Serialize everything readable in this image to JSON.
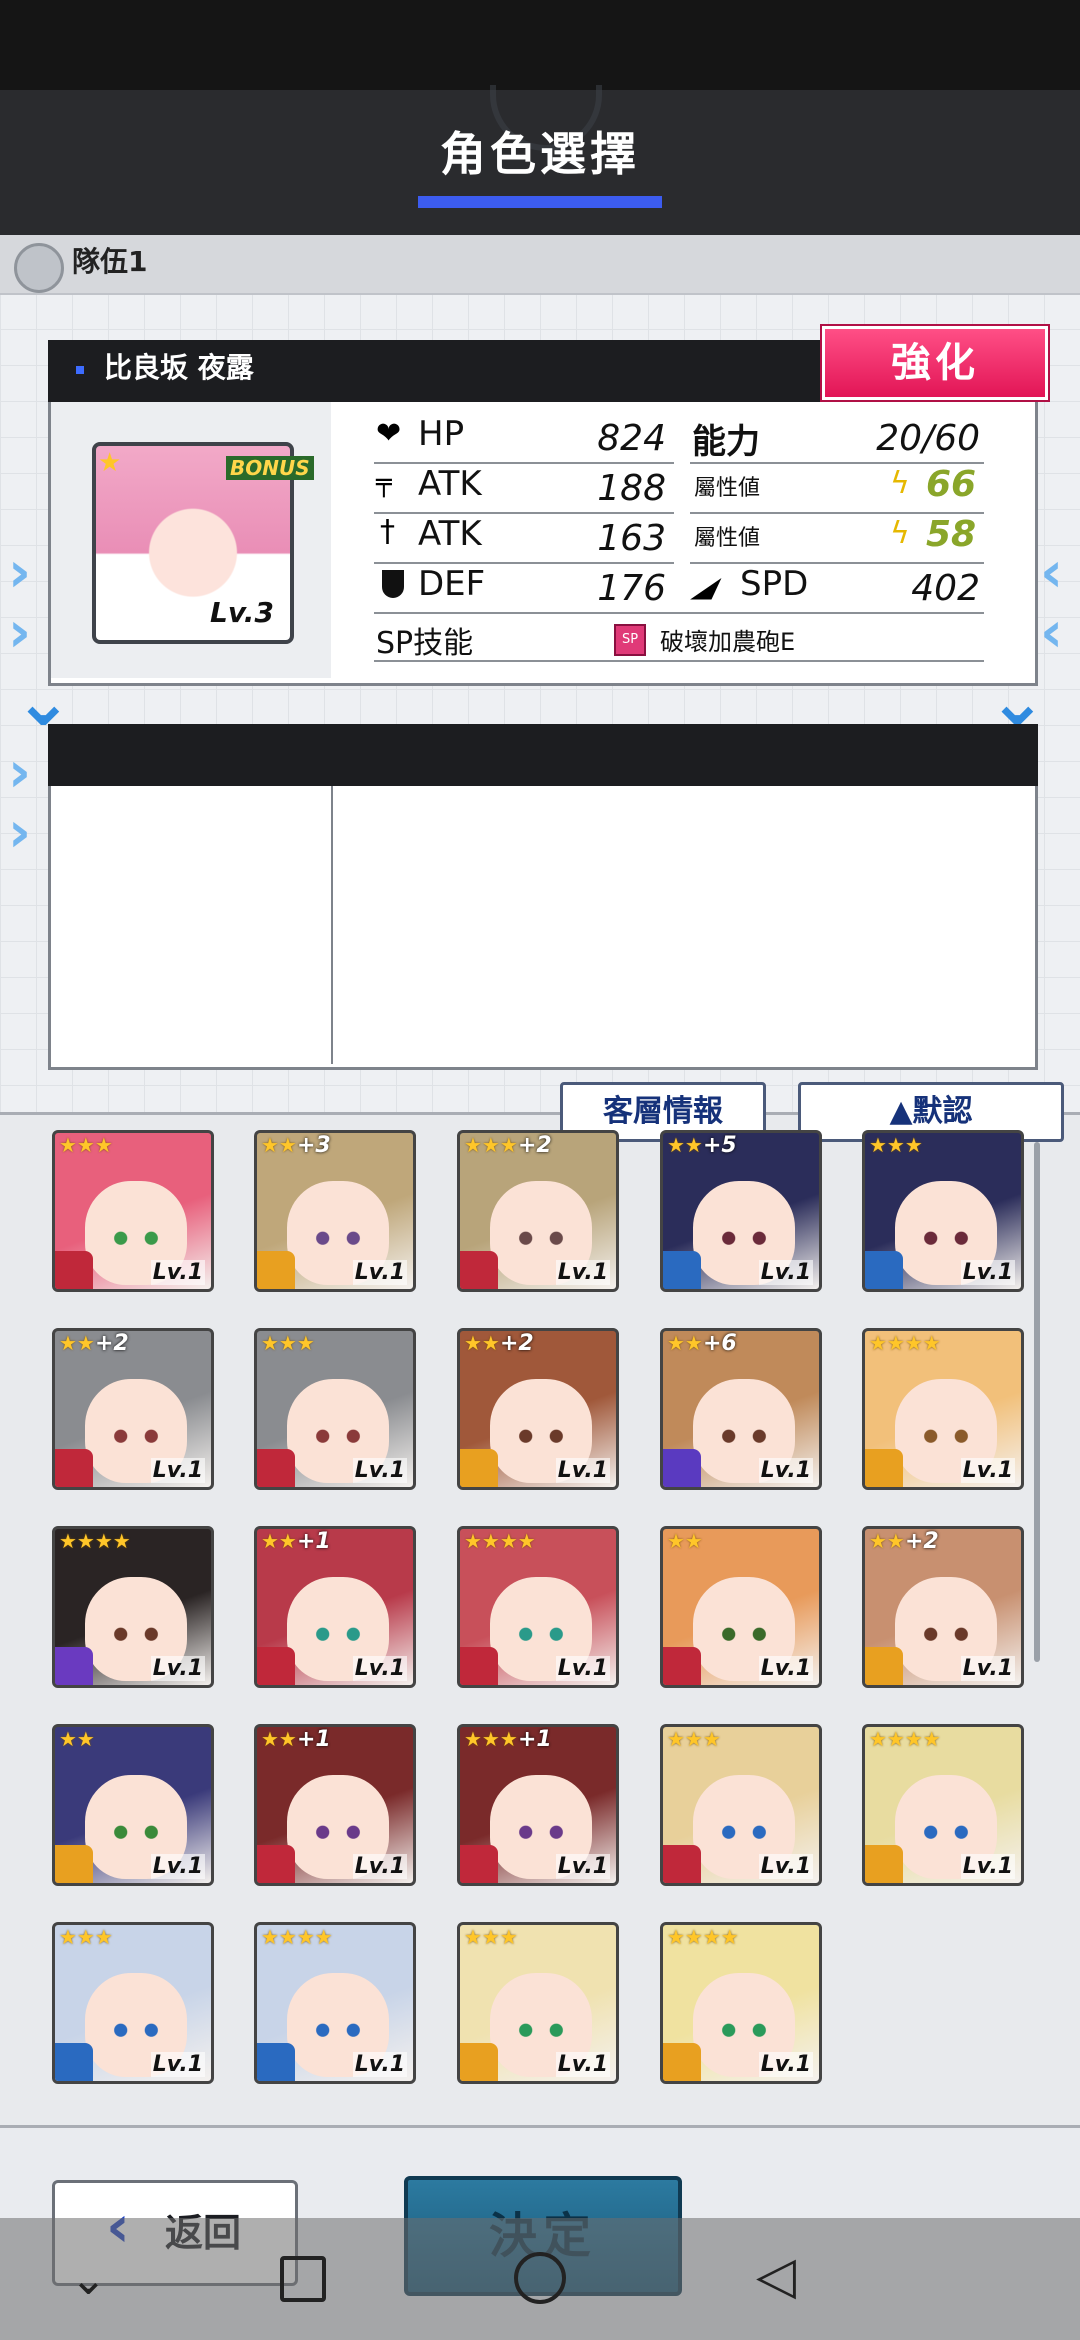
{
  "header": {
    "title": "角色選擇"
  },
  "team": {
    "label": "隊伍1"
  },
  "enhance_button": "強化",
  "selected": {
    "name": "比良坂 夜露",
    "bonus": "BONUS",
    "level": "Lv.3",
    "stars": "★",
    "stats": {
      "hp_label": "HP",
      "hp": "824",
      "atk1_label": "ATK",
      "atk1": "188",
      "atk2_label": "ATK",
      "atk2": "163",
      "def_label": "DEF",
      "def": "176",
      "ability_label": "能力",
      "ability": "20/60",
      "attr_label": "屬性値",
      "attr1": "66",
      "attr2": "58",
      "spd_label": "SPD",
      "spd": "402",
      "sp_label": "SP技能",
      "sp_badge": "SP",
      "sp_skill": "破壞加農砲E"
    }
  },
  "tabs": {
    "layer": "客層情報",
    "default": "▲默認"
  },
  "roster": [
    {
      "stars": "★★★",
      "plus": "",
      "lv": "Lv.1",
      "hair": "#e8607c",
      "eye": "#3a9a4a",
      "w": "#c0283a"
    },
    {
      "stars": "★★",
      "plus": "+3",
      "lv": "Lv.1",
      "hair": "#bfa77a",
      "eye": "#6a4a8a",
      "w": "#e8a020"
    },
    {
      "stars": "★★★",
      "plus": "+2",
      "lv": "Lv.1",
      "hair": "#b8a47a",
      "eye": "#6a4a4a",
      "w": "#c0283a"
    },
    {
      "stars": "★★",
      "plus": "+5",
      "lv": "Lv.1",
      "hair": "#2b2d5a",
      "eye": "#6a2a3a",
      "w": "#2a6ac0"
    },
    {
      "stars": "★★★",
      "plus": "",
      "lv": "Lv.1",
      "hair": "#2b2d5a",
      "eye": "#6a2a3a",
      "w": "#2a6ac0"
    },
    {
      "stars": "★★",
      "plus": "+2",
      "lv": "Lv.1",
      "hair": "#8a8c90",
      "eye": "#8a3a3a",
      "w": "#c0283a"
    },
    {
      "stars": "★★★",
      "plus": "",
      "lv": "Lv.1",
      "hair": "#8a8c90",
      "eye": "#8a3a3a",
      "w": "#c0283a"
    },
    {
      "stars": "★★",
      "plus": "+2",
      "lv": "Lv.1",
      "hair": "#a0583a",
      "eye": "#6a3a2a",
      "w": "#e8a020"
    },
    {
      "stars": "★★",
      "plus": "+6",
      "lv": "Lv.1",
      "hair": "#c08a5a",
      "eye": "#6a3a2a",
      "w": "#5a3ac0"
    },
    {
      "stars": "★★★★",
      "plus": "",
      "lv": "Lv.1",
      "hair": "#f2c07a",
      "eye": "#8a5a2a",
      "w": "#e8a020"
    },
    {
      "stars": "★★★★",
      "plus": "",
      "lv": "Lv.1",
      "hair": "#2a2424",
      "eye": "#6a3a2a",
      "w": "#6a3ac0"
    },
    {
      "stars": "★★",
      "plus": "+1",
      "lv": "Lv.1",
      "hair": "#b83a4a",
      "eye": "#2a9a8a",
      "w": "#c0283a"
    },
    {
      "stars": "★★★★",
      "plus": "",
      "lv": "Lv.1",
      "hair": "#c8505a",
      "eye": "#2a9a8a",
      "w": "#c0283a"
    },
    {
      "stars": "★★",
      "plus": "",
      "lv": "Lv.1",
      "hair": "#e89a5a",
      "eye": "#3a6a2a",
      "w": "#c0283a"
    },
    {
      "stars": "★★",
      "plus": "+2",
      "lv": "Lv.1",
      "hair": "#c89070",
      "eye": "#6a3a2a",
      "w": "#e8a020"
    },
    {
      "stars": "★★",
      "plus": "",
      "lv": "Lv.1",
      "hair": "#3a3a7a",
      "eye": "#3a8a3a",
      "w": "#e8a020"
    },
    {
      "stars": "★★",
      "plus": "+1",
      "lv": "Lv.1",
      "hair": "#7a2a2a",
      "eye": "#6a3a8a",
      "w": "#c0283a"
    },
    {
      "stars": "★★★",
      "plus": "+1",
      "lv": "Lv.1",
      "hair": "#7a2a2a",
      "eye": "#6a3a8a",
      "w": "#c0283a"
    },
    {
      "stars": "★★★",
      "plus": "",
      "lv": "Lv.1",
      "hair": "#e8d09a",
      "eye": "#2a6ac0",
      "w": "#c0283a"
    },
    {
      "stars": "★★★★",
      "plus": "",
      "lv": "Lv.1",
      "hair": "#e8dca0",
      "eye": "#2a6ac0",
      "w": "#e8a020"
    },
    {
      "stars": "★★★",
      "plus": "",
      "lv": "Lv.1",
      "hair": "#c8d4e8",
      "eye": "#2a6ac0",
      "w": "#2a6ac0"
    },
    {
      "stars": "★★★★",
      "plus": "",
      "lv": "Lv.1",
      "hair": "#c8d4e8",
      "eye": "#2a6ac0",
      "w": "#2a6ac0"
    },
    {
      "stars": "★★★",
      "plus": "",
      "lv": "Lv.1",
      "hair": "#f0e2b0",
      "eye": "#2a9a5a",
      "w": "#e8a020"
    },
    {
      "stars": "★★★★",
      "plus": "",
      "lv": "Lv.1",
      "hair": "#f0e2a0",
      "eye": "#2a9a5a",
      "w": "#e8a020"
    }
  ],
  "buttons": {
    "back": "返回",
    "decide": "決定"
  },
  "icons": {
    "team": "team-emblem-icon",
    "heart": "heart-icon",
    "gun": "gun-icon",
    "sword": "sword-icon",
    "shield": "shield-icon",
    "wing": "wing-icon",
    "bolt": "lightning-icon"
  }
}
